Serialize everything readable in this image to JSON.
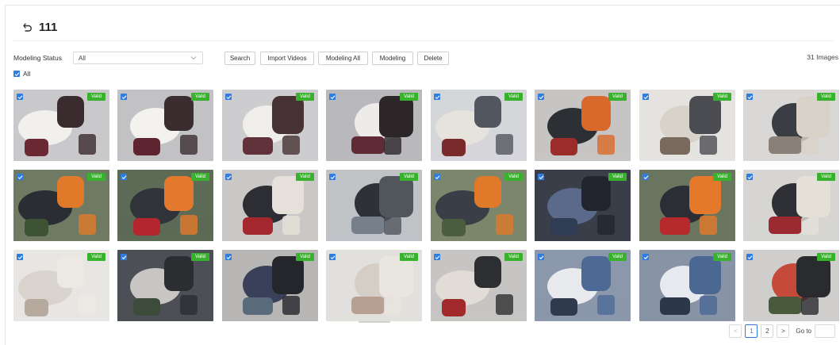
{
  "header": {
    "title": "111",
    "back_icon": "back-arrow-icon"
  },
  "filter": {
    "status_label": "Modeling Status",
    "status_value": "All",
    "buttons": {
      "search": "Search",
      "import": "Import Videos",
      "modeling_all": "Modeling All",
      "modeling": "Modeling",
      "delete": "Delete"
    },
    "image_count": "31 Images"
  },
  "select_all_label": "All",
  "accent_color": "#2f7de1",
  "valid_color": "#38b22c",
  "tiles": [
    {
      "badge": "Valid",
      "checked": true
    },
    {
      "badge": "Valid",
      "checked": true
    },
    {
      "badge": "Valid",
      "checked": true
    },
    {
      "badge": "Valid",
      "checked": true
    },
    {
      "badge": "Valid",
      "checked": true
    },
    {
      "badge": "Valid",
      "checked": true
    },
    {
      "badge": "Valid",
      "checked": true
    },
    {
      "badge": "Valid",
      "checked": true
    },
    {
      "badge": "Valid",
      "checked": true
    },
    {
      "badge": "Valid",
      "checked": true
    },
    {
      "badge": "Valid",
      "checked": true
    },
    {
      "badge": "Valid",
      "checked": true
    },
    {
      "badge": "Valid",
      "checked": true
    },
    {
      "badge": "Valid",
      "checked": true
    },
    {
      "badge": "Valid",
      "checked": true
    },
    {
      "badge": "Valid",
      "checked": true
    },
    {
      "badge": "Valid",
      "checked": true
    },
    {
      "badge": "Valid",
      "checked": true
    },
    {
      "badge": "Valid",
      "checked": true
    },
    {
      "badge": "Valid",
      "checked": true
    },
    {
      "badge": "Valid",
      "checked": true
    },
    {
      "badge": "Valid",
      "checked": true
    },
    {
      "badge": "Valid",
      "checked": true
    },
    {
      "badge": "Valid",
      "checked": true
    }
  ],
  "pagination": {
    "prev": "<",
    "pages": [
      "1",
      "2"
    ],
    "current": "1",
    "next": ">",
    "goto_label": "Go to"
  }
}
